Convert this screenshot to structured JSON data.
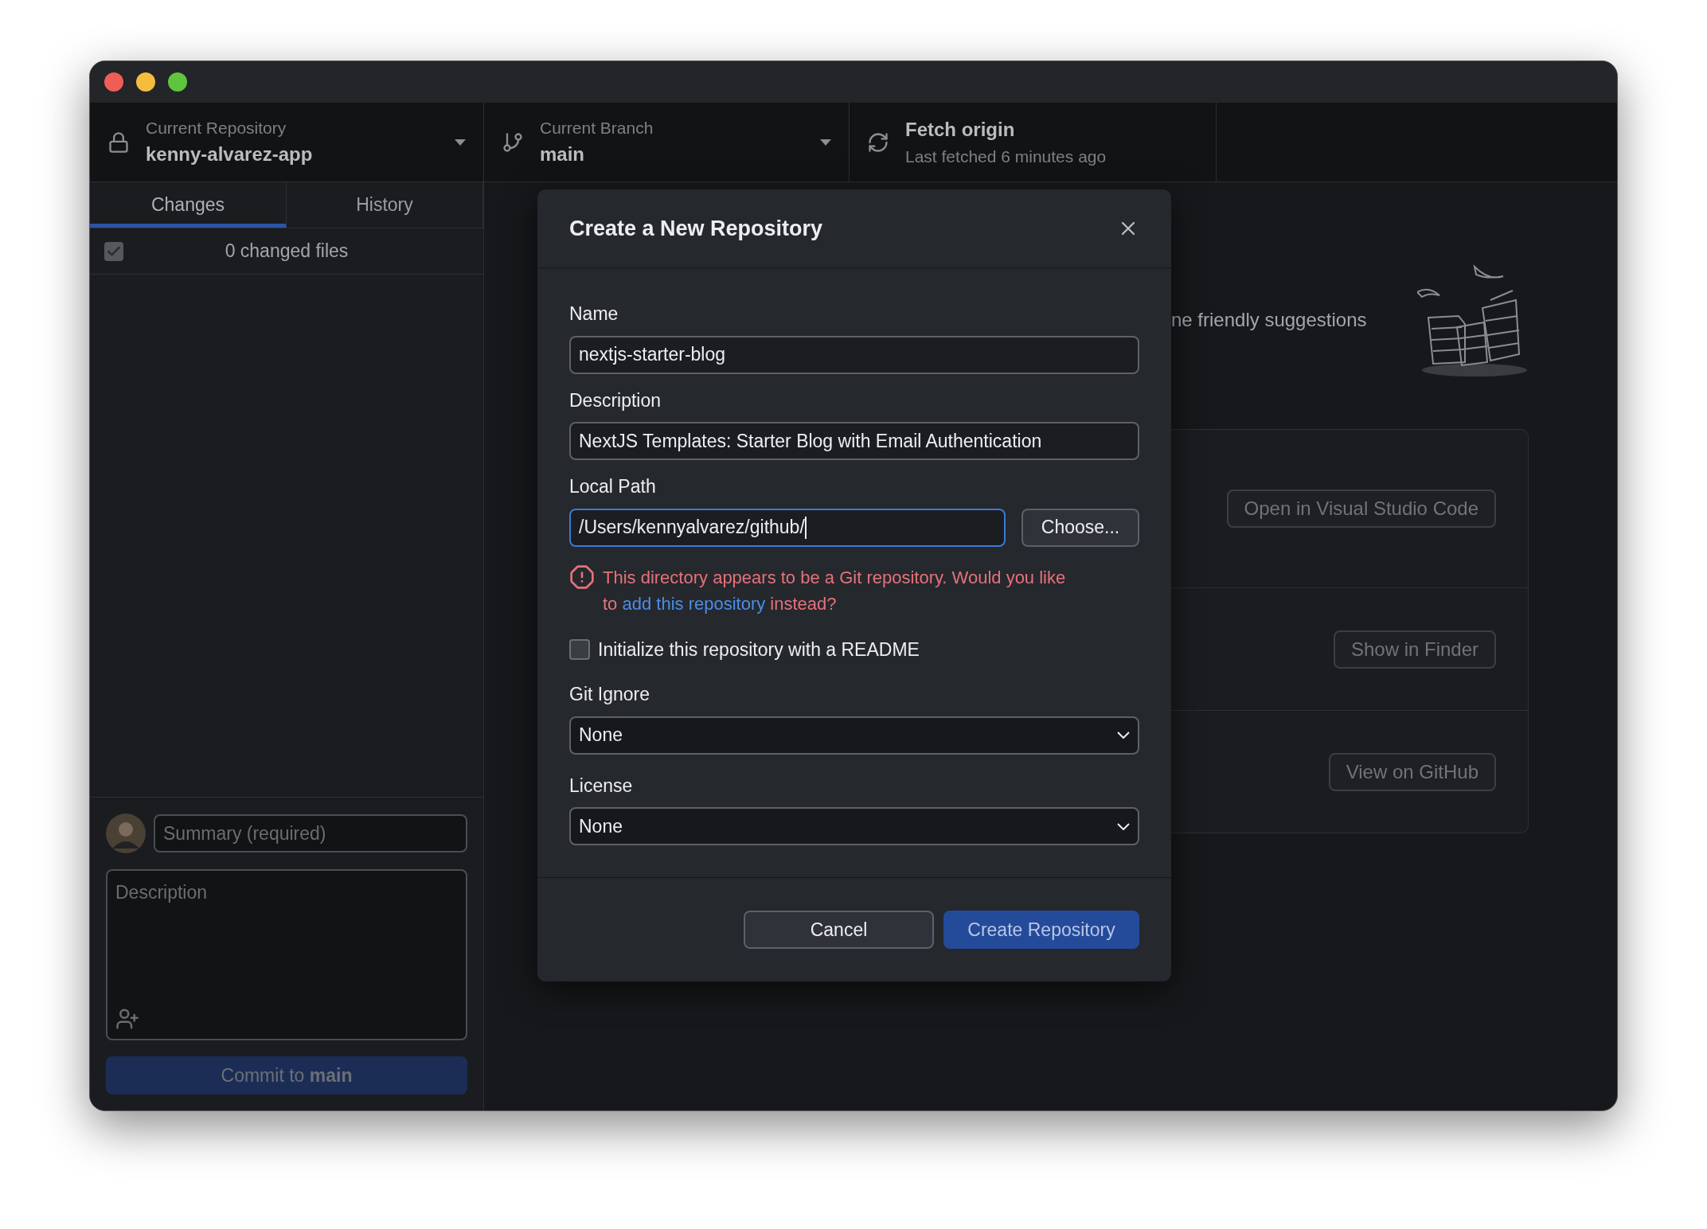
{
  "toolbar": {
    "repository": {
      "label": "Current Repository",
      "value": "kenny-alvarez-app"
    },
    "branch": {
      "label": "Current Branch",
      "value": "main"
    },
    "fetch": {
      "label": "Fetch origin",
      "detail": "Last fetched 6 minutes ago"
    }
  },
  "tabs": [
    {
      "label": "Changes",
      "selected": true
    },
    {
      "label": "History",
      "selected": false
    }
  ],
  "changes": {
    "select_all_checked": true,
    "summary": "0 changed files"
  },
  "commit": {
    "summary_placeholder": "Summary (required)",
    "description_placeholder": "Description",
    "button": "Commit to **main**"
  },
  "background": {
    "suggestions": "ne friendly suggestions",
    "actions": [
      "Open in Visual Studio Code",
      "Show in Finder",
      "View on GitHub"
    ]
  },
  "dialog": {
    "title": "Create a New Repository",
    "fields": [
      {
        "label": "Name",
        "value": "nextjs-starter-blog",
        "focused": false
      },
      {
        "label": "Description",
        "value": "NextJS Templates: Starter Blog with Email Authentication",
        "focused": false
      }
    ],
    "local_path": {
      "label": "Local Path",
      "value": "/Users/kennyalvarez/github/",
      "focused": true,
      "button": "Choose..."
    },
    "error": {
      "before": "This directory appears to be a Git repository. Would you like to ",
      "link": "add this repository",
      "after": " instead?"
    },
    "readme": {
      "label": "Initialize this repository with a README",
      "checked": false
    },
    "selects": [
      {
        "label": "Git Ignore",
        "value": "None"
      },
      {
        "label": "License",
        "value": "None"
      }
    ],
    "buttons": [
      {
        "label": "Cancel",
        "kind": "secondary"
      },
      {
        "label": "Create Repository",
        "kind": "primary"
      }
    ]
  }
}
